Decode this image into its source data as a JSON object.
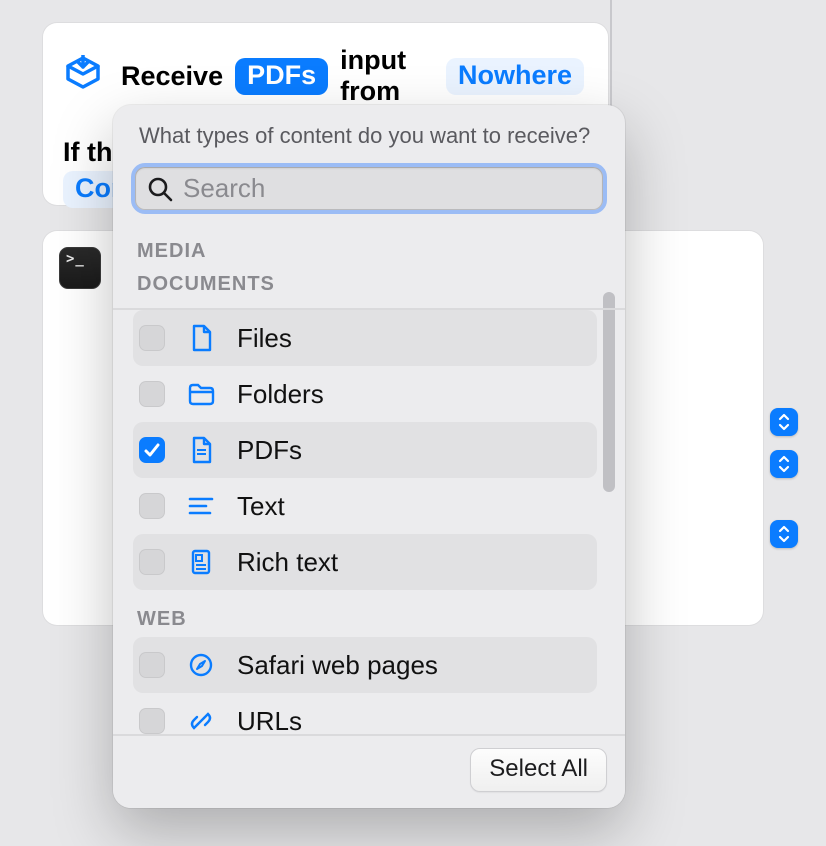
{
  "receive": {
    "prefix": "Receive",
    "type_token": "PDFs",
    "middle": "input from",
    "from_token": "Nowhere",
    "if_prefix": "If the",
    "continue_token": "Cont"
  },
  "popover": {
    "title": "What types of content do you want to receive?",
    "search_placeholder": "Search",
    "sections": {
      "media": "MEDIA",
      "documents": "DOCUMENTS",
      "web": "WEB"
    },
    "items": {
      "files": {
        "label": "Files",
        "checked": false
      },
      "folders": {
        "label": "Folders",
        "checked": false
      },
      "pdfs": {
        "label": "PDFs",
        "checked": true
      },
      "text": {
        "label": "Text",
        "checked": false
      },
      "richtext": {
        "label": "Rich text",
        "checked": false
      },
      "safari": {
        "label": "Safari web pages",
        "checked": false
      },
      "urls": {
        "label": "URLs",
        "checked": false
      }
    },
    "select_all": "Select All"
  },
  "colors": {
    "accent": "#0a7cff"
  }
}
